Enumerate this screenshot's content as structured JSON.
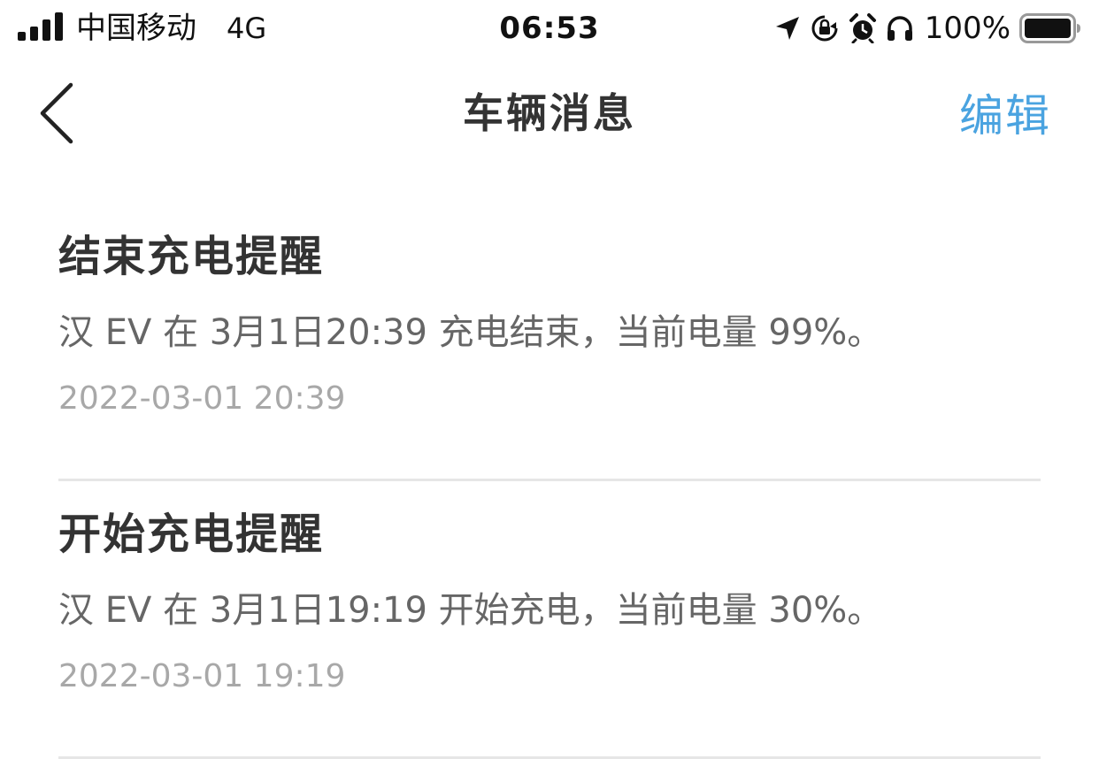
{
  "status_bar": {
    "carrier": "中国移动",
    "network": "4G",
    "time": "06:53",
    "battery_percent": "100%",
    "icons": [
      "signal-bars-icon",
      "location-arrow-icon",
      "rotation-lock-icon",
      "alarm-icon",
      "headphones-icon",
      "battery-icon"
    ]
  },
  "nav": {
    "title": "车辆消息",
    "edit_label": "编辑",
    "back_icon": "chevron-left-icon",
    "accent_color": "#4aa3e0"
  },
  "messages": [
    {
      "title": "结束充电提醒",
      "body": "汉 EV 在 3月1日20:39 充电结束，当前电量 99%。",
      "time": "2022-03-01 20:39"
    },
    {
      "title": "开始充电提醒",
      "body": "汉 EV 在 3月1日19:19 开始充电，当前电量 30%。",
      "time": "2022-03-01 19:19"
    }
  ]
}
